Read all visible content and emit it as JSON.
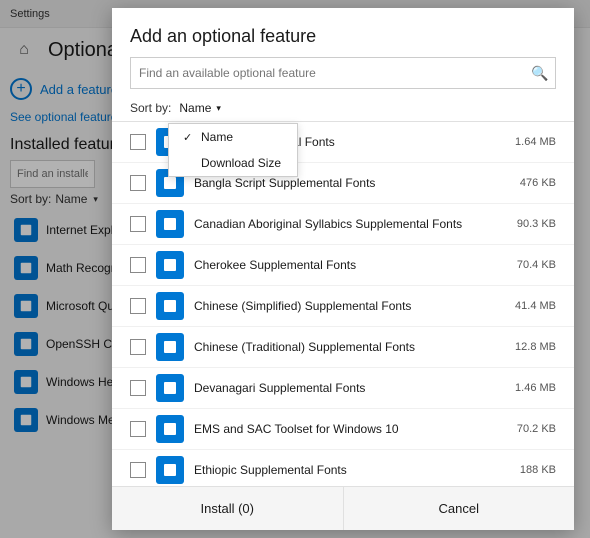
{
  "titlebar": {
    "label": "Settings"
  },
  "sidebar": {
    "home_icon": "⌂",
    "page_title": "Optional",
    "add_feature_label": "Add a feature",
    "optional_link": "See optional feature hi...",
    "installed_title": "Installed features",
    "search_placeholder": "Find an installed optio...",
    "sort_label": "Sort by:",
    "sort_value": "Name",
    "items": [
      {
        "label": "Internet Explore..."
      },
      {
        "label": "Math Recognize..."
      },
      {
        "label": "Microsoft Quick..."
      },
      {
        "label": "OpenSSH Client..."
      },
      {
        "label": "Windows Hello ..."
      },
      {
        "label": "Windows Media..."
      }
    ]
  },
  "modal": {
    "title": "Add an optional feature",
    "search_placeholder": "Find an available optional feature",
    "sort_label": "Sort by:",
    "sort_value": "Name",
    "dropdown": {
      "items": [
        {
          "label": "Name",
          "selected": true
        },
        {
          "label": "Download Size",
          "selected": false
        }
      ]
    },
    "features": [
      {
        "name": "Script Supplemental Fonts",
        "size": "1.64 MB",
        "checked": false
      },
      {
        "name": "Bangla Script Supplemental Fonts",
        "size": "476 KB",
        "checked": false
      },
      {
        "name": "Canadian Aboriginal Syllabics Supplemental Fonts",
        "size": "90.3 KB",
        "checked": false
      },
      {
        "name": "Cherokee Supplemental Fonts",
        "size": "70.4 KB",
        "checked": false
      },
      {
        "name": "Chinese (Simplified) Supplemental Fonts",
        "size": "41.4 MB",
        "checked": false
      },
      {
        "name": "Chinese (Traditional) Supplemental Fonts",
        "size": "12.8 MB",
        "checked": false
      },
      {
        "name": "Devanagari Supplemental Fonts",
        "size": "1.46 MB",
        "checked": false
      },
      {
        "name": "EMS and SAC Toolset for Windows 10",
        "size": "70.2 KB",
        "checked": false
      },
      {
        "name": "Ethiopic Supplemental Fonts",
        "size": "188 KB",
        "checked": false
      }
    ],
    "footer": {
      "install_label": "Install (0)",
      "cancel_label": "Cancel"
    }
  }
}
